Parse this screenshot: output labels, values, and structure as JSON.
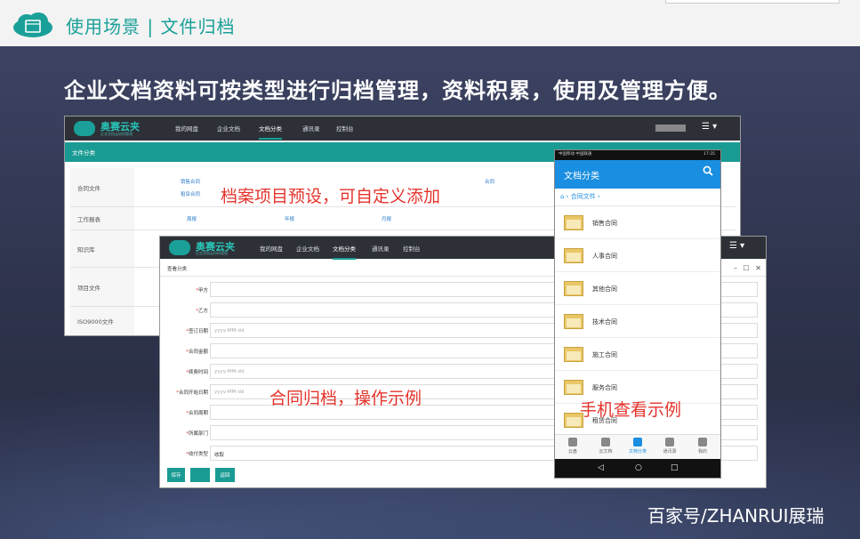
{
  "header": {
    "title": "使用场景 | 文件归档",
    "icon": "cloud-folder-icon"
  },
  "headline": "企业文档资料可按类型进行归档管理，资料积累，使用及管理方便。",
  "credit": "百家号/ZHANRUI展瑞",
  "colors": {
    "teal": "#199b93",
    "accent_red": "#e4342c",
    "phone_blue": "#1a8ee0"
  },
  "web": {
    "brand": "奥赛云夹",
    "brand_sub": "企业文档云协同管理",
    "nav": [
      "我的网盘",
      "企业文档",
      "文档分类",
      "通讯录",
      "控制台"
    ],
    "active_nav": "文档分类",
    "menu_glyph": "☰ ▾"
  },
  "w1": {
    "section": "文件分类",
    "rows": [
      {
        "label": "合同文件",
        "links": [
          "销售合同",
          "租赁合同",
          "合同"
        ]
      },
      {
        "label": "工作报表",
        "links": [
          "周报",
          "年报",
          "月报"
        ]
      },
      {
        "label": "知识库",
        "links": []
      },
      {
        "label": "项目文件",
        "links": []
      },
      {
        "label": "ISO9000文件",
        "links": []
      }
    ],
    "annotation": "档案项目预设，可自定义添加"
  },
  "w2": {
    "crumb": "查看分类",
    "window_controls": "– ☐ ✕",
    "fields": [
      {
        "label": "甲方",
        "value": "",
        "placeholder": ""
      },
      {
        "label": "乙方",
        "value": "",
        "placeholder": ""
      },
      {
        "label": "签订日期",
        "value": "",
        "placeholder": "yyyy-MM-dd"
      },
      {
        "label": "合同金额",
        "value": "",
        "placeholder": ""
      },
      {
        "label": "续费时间",
        "value": "",
        "placeholder": "yyyy-MM-dd"
      },
      {
        "label": "合同开始日期",
        "value": "",
        "placeholder": "yyyy-MM-dd"
      },
      {
        "label": "合同周期",
        "value": "",
        "placeholder": ""
      },
      {
        "label": "所属部门",
        "value": "",
        "placeholder": ""
      },
      {
        "label": "收付类型",
        "value": "收取",
        "placeholder": ""
      }
    ],
    "buttons": [
      "保存",
      "",
      "返回"
    ],
    "annotation": "合同归档，操作示例"
  },
  "phone": {
    "status_left": "中国移动 中国联通",
    "status_right": "17:35",
    "header_title": "文档分类",
    "path": "合同文件",
    "items": [
      "销售合同",
      "人事合同",
      "其他合同",
      "技术合同",
      "施工合同",
      "服务合同",
      "租赁合同"
    ],
    "tabs": [
      "云盘",
      "云文档",
      "文档分类",
      "通讯录",
      "我的"
    ],
    "active_tab": "文档分类",
    "annotation": "手机查看示例",
    "nav_keys": [
      "◁",
      "○",
      "□"
    ]
  }
}
